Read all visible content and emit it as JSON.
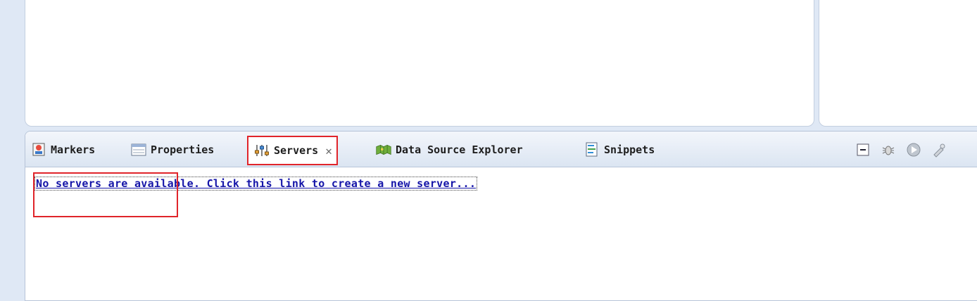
{
  "tabs": [
    {
      "label": "Markers",
      "icon": "markers-icon"
    },
    {
      "label": "Properties",
      "icon": "properties-icon"
    },
    {
      "label": "Servers",
      "icon": "servers-icon",
      "active": true,
      "closable": true
    },
    {
      "label": "Data Source Explorer",
      "icon": "data-source-explorer-icon"
    },
    {
      "label": "Snippets",
      "icon": "snippets-icon"
    }
  ],
  "toolbar": [
    "collapse-icon",
    "debug-icon",
    "start-icon",
    "publish-icon"
  ],
  "servers_view": {
    "link_text": "No servers are available. Click this link to create a new server..."
  },
  "colors": {
    "highlight": "#e0242a",
    "link": "#1414a8",
    "tabbar_bg": "#dbe5f2"
  }
}
